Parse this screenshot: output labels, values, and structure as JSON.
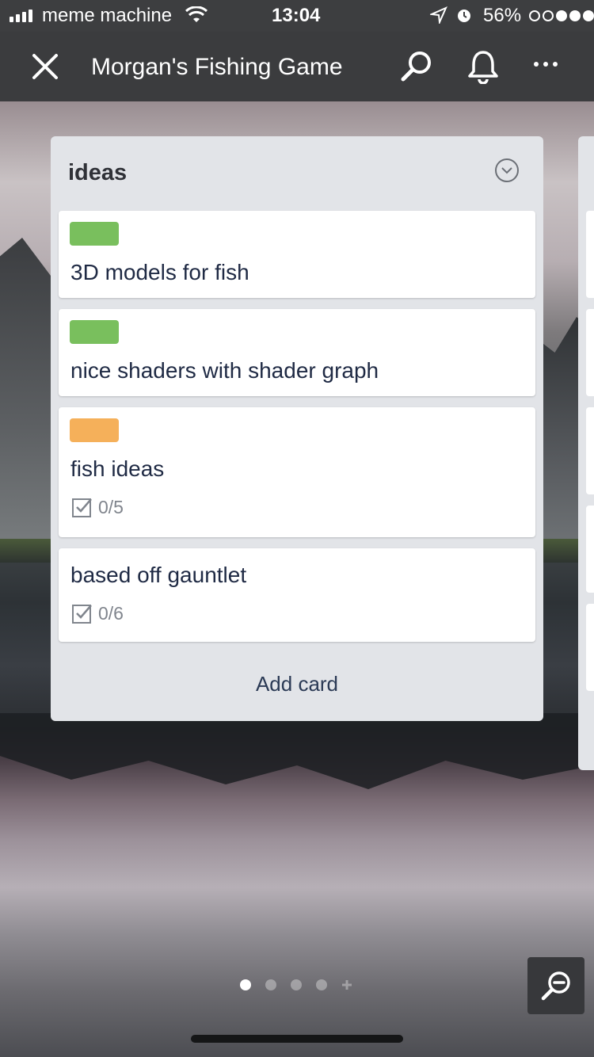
{
  "status_bar": {
    "carrier": "meme machine",
    "time": "13:04",
    "battery": "56%"
  },
  "nav": {
    "title": "Morgan's Fishing Game"
  },
  "list": {
    "title": "ideas",
    "cards": [
      {
        "title": "3D models for fish",
        "label_color": "#79bf5d"
      },
      {
        "title": "nice shaders with shader graph",
        "label_color": "#79bf5d"
      },
      {
        "title": "fish ideas",
        "label_color": "#f5b05a",
        "checklist": "0/5"
      },
      {
        "title": "based off gauntlet",
        "checklist": "0/6"
      }
    ],
    "add_card_label": "Add card"
  },
  "pager": {
    "count": 5,
    "active": 1
  },
  "colors": {
    "label_green": "#79bf5d",
    "label_orange": "#f5b05a",
    "list_bg": "#e2e4e8",
    "nav_bg": "#3b3c3e"
  },
  "icons": [
    "close-icon",
    "search-icon",
    "bell-icon",
    "more-icon",
    "chevron-down-icon",
    "checklist-icon",
    "zoom-out-icon"
  ]
}
